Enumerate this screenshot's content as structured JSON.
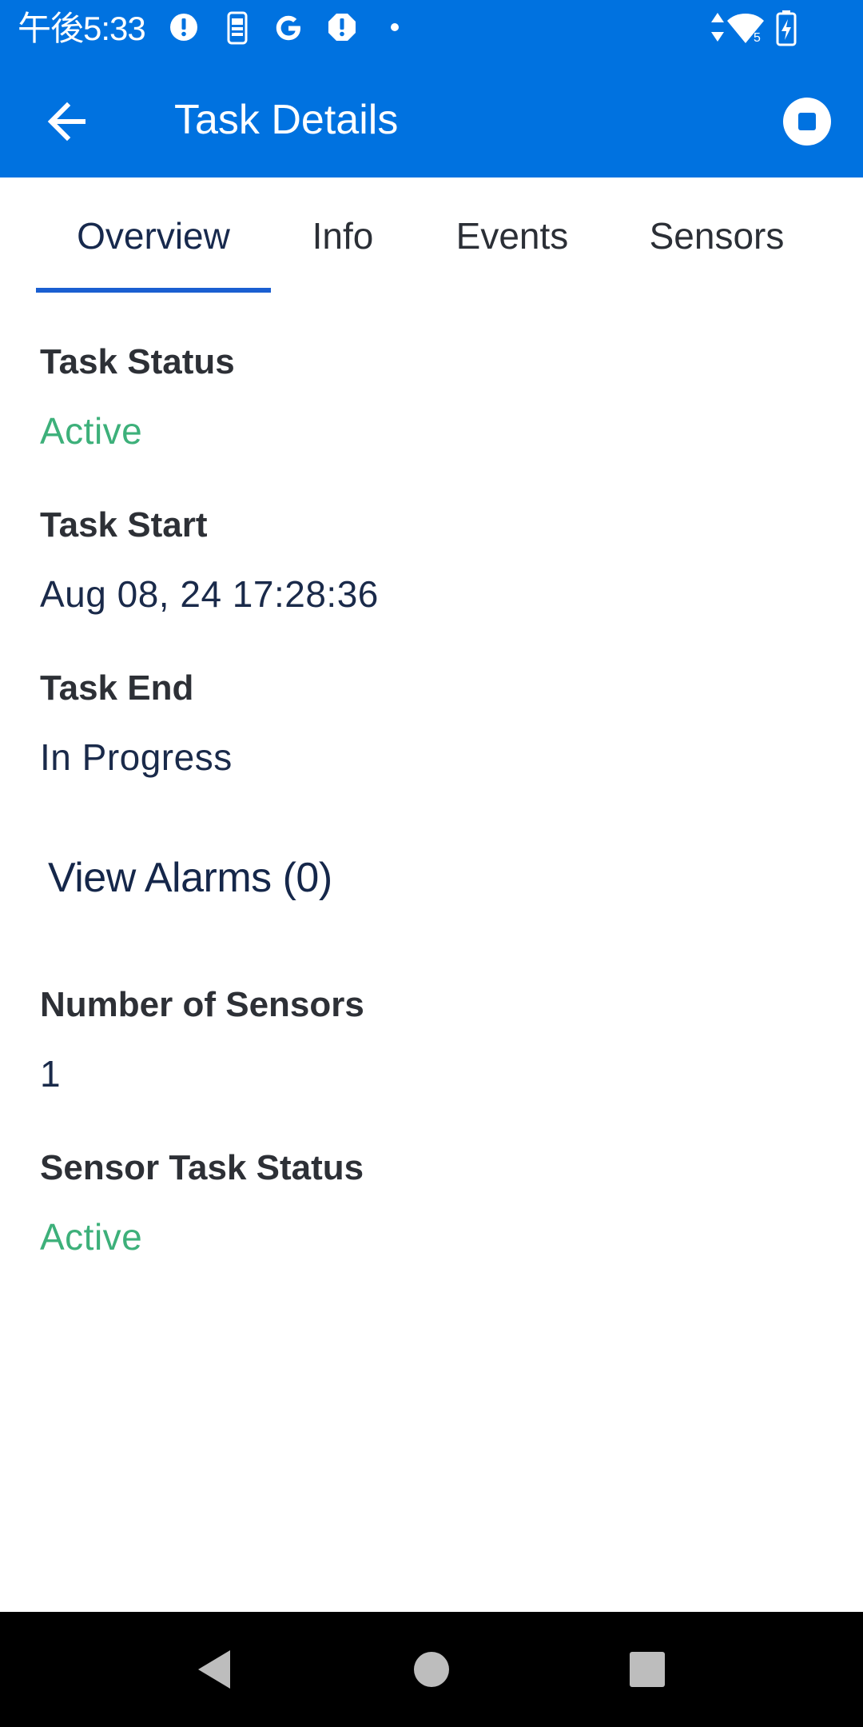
{
  "status_bar": {
    "time": "午後5:33",
    "icons_left": [
      "alert-icon",
      "phone-icon",
      "google-icon",
      "alert-icon",
      "dot-icon"
    ],
    "icons_right": [
      "data-arrows-icon",
      "wifi-icon",
      "battery-charging-icon"
    ],
    "wifi_badge": "5"
  },
  "app_bar": {
    "title": "Task Details",
    "back_icon": "arrow-left-icon",
    "stop_icon": "stop-circle-icon"
  },
  "tabs": [
    {
      "label": "Overview",
      "active": true
    },
    {
      "label": "Info",
      "active": false
    },
    {
      "label": "Events",
      "active": false
    },
    {
      "label": "Sensors",
      "active": false
    }
  ],
  "overview": {
    "task_status": {
      "label": "Task Status",
      "value": "Active"
    },
    "task_start": {
      "label": "Task Start",
      "value": "Aug 08, 24 17:28:36"
    },
    "task_end": {
      "label": "Task End",
      "value": "In Progress"
    },
    "alarms_link": "View Alarms (0)",
    "number_of_sensors": {
      "label": "Number of Sensors",
      "value": "1"
    },
    "sensor_task_status": {
      "label": "Sensor Task Status",
      "value": "Active"
    }
  },
  "nav_bar": {
    "buttons": [
      "back-triangle-icon",
      "home-circle-icon",
      "recents-square-icon"
    ]
  },
  "colors": {
    "primary": "#0072e0",
    "tab_indicator": "#1a5fd1",
    "status_active": "#3db07a",
    "nav_bar": "#000000"
  }
}
